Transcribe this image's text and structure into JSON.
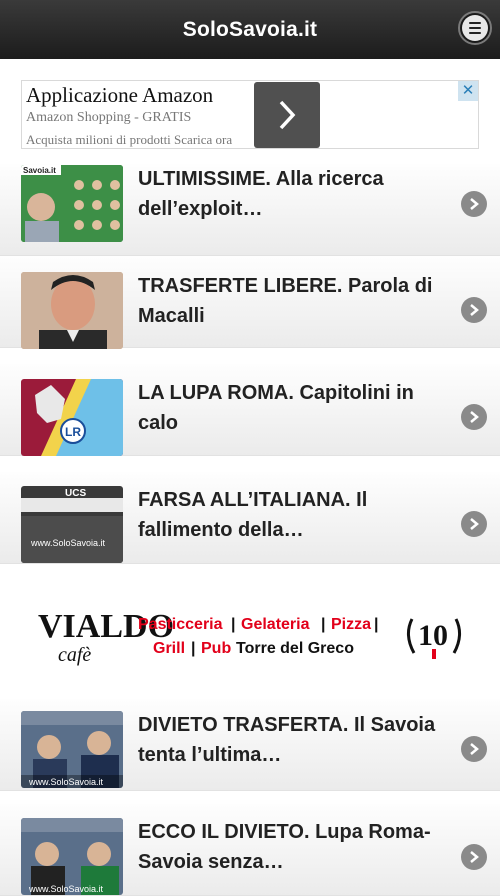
{
  "header": {
    "title": "SoloSavoia.it"
  },
  "ad": {
    "title": "Applicazione Amazon",
    "subtitle": "Amazon Shopping - GRATIS",
    "description": "Acquista milioni di prodotti Scarica ora",
    "close": "✕"
  },
  "articles": [
    {
      "title": "ULTIMISSIME. Alla ricerca dell’exploit…",
      "thumb_text": "Savoia.it"
    },
    {
      "title": "TRASFERTE LIBERE. Parola di Macalli"
    },
    {
      "title": "LA LUPA ROMA. Capitolini in calo",
      "thumb_text": "LR"
    },
    {
      "title": "FARSA ALL’ITALIANA. Il fallimento della…",
      "thumb_text": "www.SoloSavoia.it",
      "thumb_text2": "UCS"
    },
    {
      "title": "DIVIETO TRASFERTA. Il Savoia tenta l’ultima…",
      "thumb_text": "www.SoloSavoia.it"
    },
    {
      "title": "ECCO IL DIVIETO. Lupa Roma-Savoia senza…",
      "thumb_text": "www.SoloSavoia.it"
    }
  ],
  "banner": {
    "brand": "VIALDO",
    "brand_sub": "cafè",
    "line1_a": "Pasticceria",
    "line1_b": "Gelateria",
    "line1_c": "Pizza",
    "line2_a": "Grill",
    "line2_b": "Pub",
    "line2_c": "Torre del Greco",
    "anniversary": "10"
  },
  "colors": {
    "header_bg": "#2a2a2a",
    "banner_red": "#e2001a",
    "chevron": "#8a8a8a"
  }
}
